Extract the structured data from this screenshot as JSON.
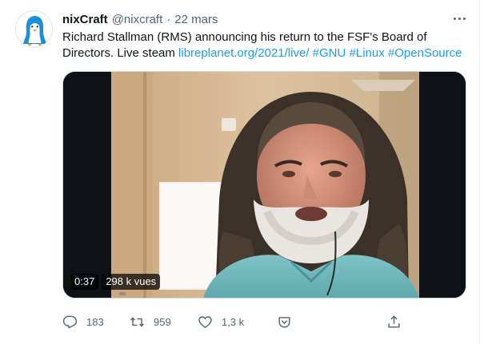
{
  "tweet": {
    "display_name": "nixCraft",
    "handle": "@nixcraft",
    "separator": "·",
    "date": "22 mars",
    "text": {
      "before_link": "Richard Stallman (RMS) announcing his return to the FSF's Board of Directors. Live steam ",
      "link": "libreplanet.org/2021/live/",
      "hashtags": [
        "#GNU",
        "#Linux",
        "#OpenSource"
      ]
    }
  },
  "media": {
    "time": "0:37",
    "views": "298 k vues"
  },
  "actions": {
    "reply_count": "183",
    "retweet_count": "959",
    "like_count": "1,3 k"
  },
  "icons": {
    "avatar": "penguin-logo",
    "more": "more-icon",
    "reply": "reply-icon",
    "retweet": "retweet-icon",
    "like": "heart-icon",
    "tip": "tip-icon",
    "share": "share-icon"
  },
  "colors": {
    "link": "#1d9bf0",
    "muted": "#536471",
    "text": "#0f1419"
  }
}
